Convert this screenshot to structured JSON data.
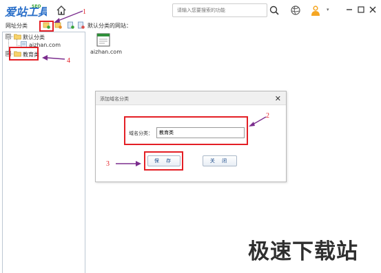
{
  "app": {
    "logo_text": "爱站工具包",
    "logo_sub": "SEO"
  },
  "search": {
    "placeholder": "请输入您要搜索的功能"
  },
  "toolbar": {
    "label": "网址分类"
  },
  "right_panel": {
    "title": "默认分类的网站：",
    "site_label": "aizhan.com"
  },
  "tree": {
    "items": [
      {
        "label": "默认分类",
        "toggle": "⊟"
      },
      {
        "label": "aizhan.com"
      },
      {
        "label": "教育类",
        "toggle": "⊞"
      }
    ]
  },
  "dialog": {
    "title": "添加域名分类",
    "close": "✕",
    "field_label": "域名分类：",
    "field_value": "教育类",
    "save_label": "保 存",
    "close_label": "关 闭"
  },
  "annotations": [
    "1",
    "2",
    "3",
    "4"
  ],
  "watermark": "极速下载站",
  "colors": {
    "annotation_red": "#e31e24",
    "arrow_purple": "#7b2d8e",
    "logo_blue": "#2a6fc9",
    "logo_green": "#3aa53a"
  }
}
